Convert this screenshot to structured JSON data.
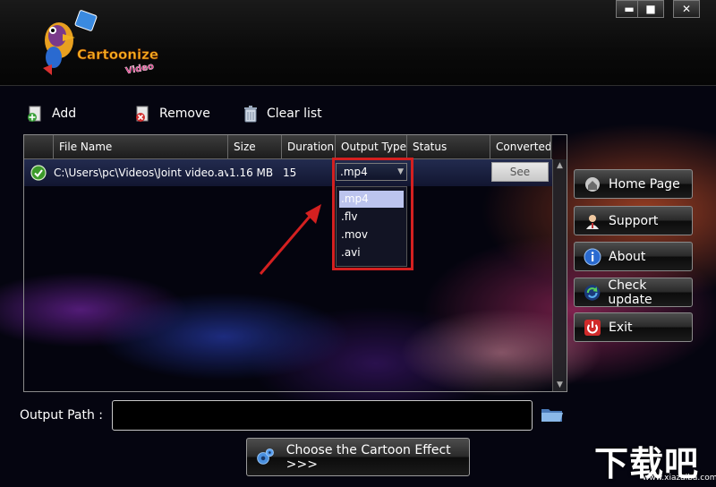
{
  "app": {
    "logo_text_1": "Cartoonize",
    "logo_text_2": "Video"
  },
  "window_controls": {
    "minimize": "▬",
    "maximize": "■",
    "close": "✕"
  },
  "toolbar": {
    "add_label": "Add",
    "remove_label": "Remove",
    "clear_label": "Clear list"
  },
  "table": {
    "columns": [
      "File Name",
      "Size",
      "Duration",
      "Output Type",
      "Status",
      "Converted"
    ],
    "rows": [
      {
        "file_name": "C:\\Users\\pc\\Videos\\Joint video.avi",
        "size": "1.16 MB",
        "duration": "15",
        "output_type": ".mp4",
        "status": "",
        "converted_button": "See"
      }
    ]
  },
  "output_type_dropdown": {
    "options": [
      ".mp4",
      ".flv",
      ".mov",
      ".avi"
    ],
    "selected": ".mp4"
  },
  "side_buttons": {
    "home": "Home Page",
    "support": "Support",
    "about": "About",
    "check_update": "Check update",
    "exit": "Exit"
  },
  "output": {
    "label": "Output Path :",
    "value": ""
  },
  "effect_button": "Choose the Cartoon Effect >>>",
  "watermark": {
    "main": "下载吧",
    "sub": "www.xiazaiba.com"
  },
  "colors": {
    "highlight_box": "#d42020",
    "selected_option": "#bcc4ee",
    "annotation_arrow": "#d42020"
  }
}
